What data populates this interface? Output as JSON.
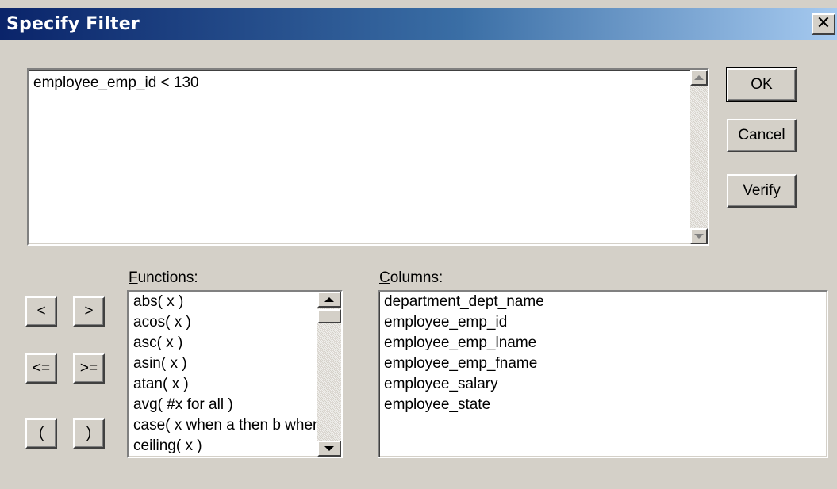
{
  "window": {
    "title": "Specify Filter",
    "close_glyph": "✕"
  },
  "expression": {
    "value": "employee_emp_id  < 130"
  },
  "buttons": {
    "ok": "OK",
    "cancel": "Cancel",
    "verify": "Verify"
  },
  "operators": [
    "<",
    ">",
    "<=",
    ">=",
    "(",
    ")"
  ],
  "functions": {
    "label_hotkey": "F",
    "label_rest": "unctions:",
    "items": [
      "abs( x )",
      "acos( x )",
      "asc( x )",
      "asin( x )",
      "atan( x )",
      "avg( #x for all )",
      "case( x when a then b when c then d else e )",
      "ceiling( x )"
    ]
  },
  "columns": {
    "label_hotkey": "C",
    "label_rest": "olumns:",
    "items": [
      "department_dept_name",
      "employee_emp_id",
      "employee_emp_lname",
      "employee_emp_fname",
      "employee_salary",
      "employee_state"
    ]
  }
}
